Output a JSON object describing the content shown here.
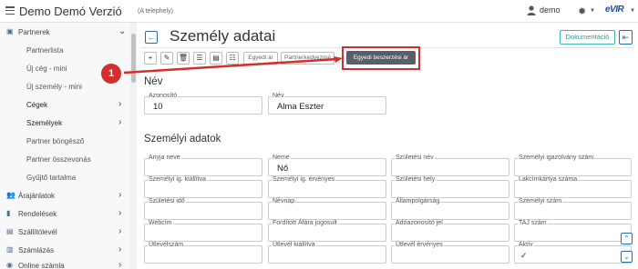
{
  "app": {
    "title": "Demo Demó Verzió",
    "subtitle": "(A telephely)",
    "user_name": "demo",
    "logo_text": "eVIR"
  },
  "sidebar": {
    "items": [
      {
        "label": "Partnerek",
        "icon": "address-book-icon",
        "level": "top",
        "chevron": "⌄"
      },
      {
        "label": "Partnerlista",
        "level": "sub"
      },
      {
        "label": "Új cég - mini",
        "level": "sub"
      },
      {
        "label": "Új személy - mini",
        "level": "sub"
      },
      {
        "label": "Cégek",
        "level": "sub2",
        "chevron": "›"
      },
      {
        "label": "Személyek",
        "level": "sub2",
        "chevron": "›"
      },
      {
        "label": "Partner böngésző",
        "level": "sub"
      },
      {
        "label": "Partner összevonás",
        "level": "sub"
      },
      {
        "label": "Gyűjtő tartalma",
        "level": "sub"
      },
      {
        "label": "Árajánlatok",
        "icon": "users-icon",
        "level": "top",
        "chevron": "›"
      },
      {
        "label": "Rendelések",
        "icon": "book-icon",
        "level": "top",
        "chevron": "›"
      },
      {
        "label": "Szállítólevél",
        "icon": "document-icon",
        "level": "top",
        "chevron": "›"
      },
      {
        "label": "Számlázás",
        "icon": "invoice-icon",
        "level": "top",
        "chevron": "›"
      },
      {
        "label": "Online számla",
        "icon": "globe-icon",
        "level": "top",
        "chevron": "›"
      }
    ]
  },
  "header": {
    "title": "Személy adatai",
    "doc_button": "Dokumentáció"
  },
  "toolbar": {
    "text_buttons": [
      "Egyedi ár",
      "Partnerkedvezmé"
    ],
    "highlight_button": "Egyedi beszerzési ár",
    "callout_number": "1"
  },
  "name_section": {
    "title": "Név",
    "fields": [
      {
        "label": "Azonosító",
        "value": "10"
      },
      {
        "label": "Név",
        "value": "Alma Eszter"
      }
    ]
  },
  "personal_section": {
    "title": "Személyi adatok",
    "rows": [
      [
        {
          "label": "Anyja neve",
          "value": ""
        },
        {
          "label": "Neme",
          "value": "Nő"
        },
        {
          "label": "Születési név",
          "value": ""
        },
        {
          "label": "Személyi igazolvány szám",
          "value": ""
        }
      ],
      [
        {
          "label": "Személyi ig. kiállítva",
          "value": ""
        },
        {
          "label": "Személyi ig. érvényes",
          "value": ""
        },
        {
          "label": "Születési hely",
          "value": ""
        },
        {
          "label": "Lakcímkártya száma",
          "value": ""
        }
      ],
      [
        {
          "label": "Születési idő",
          "value": ""
        },
        {
          "label": "Névnap",
          "value": ""
        },
        {
          "label": "Állampolgárság",
          "value": ""
        },
        {
          "label": "Személyi szám",
          "value": ""
        }
      ],
      [
        {
          "label": "Webcím",
          "value": ""
        },
        {
          "label": "Fordított Áfára jogosult",
          "value": ""
        },
        {
          "label": "Adóazonosító jel",
          "value": ""
        },
        {
          "label": "TAJ szám",
          "value": ""
        }
      ],
      [
        {
          "label": "Útlevélszám",
          "value": ""
        },
        {
          "label": "Útlevél kiállítva",
          "value": ""
        },
        {
          "label": "Útlevél érvényes",
          "value": ""
        },
        {
          "label": "Aktív",
          "value": "✓"
        }
      ]
    ]
  },
  "colors": {
    "accent": "#2b6cb0",
    "highlight": "#d32f2f",
    "doc_button": "#3fb7b0"
  }
}
